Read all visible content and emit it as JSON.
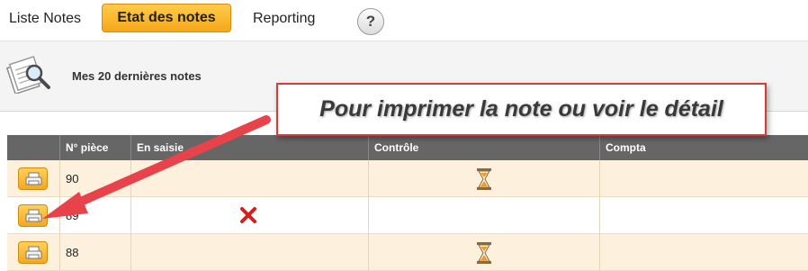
{
  "nav": {
    "items": [
      "Liste Notes",
      "Etat des notes",
      "Reporting"
    ],
    "active_index": 1,
    "help_label": "?"
  },
  "header": {
    "title": "Mes 20 dernières notes",
    "icon": "magnifier-document-icon"
  },
  "table": {
    "columns": [
      "",
      "N° pièce",
      "En saisie",
      "Contrôle",
      "Compta"
    ],
    "rows": [
      {
        "num": "90",
        "en_saisie": "",
        "controle": "hourglass-icon",
        "compta": ""
      },
      {
        "num": "89",
        "en_saisie": "x-icon",
        "controle": "",
        "compta": ""
      },
      {
        "num": "88",
        "en_saisie": "",
        "controle": "hourglass-icon",
        "compta": ""
      }
    ]
  },
  "callout": {
    "text": "Pour imprimer la note ou voir le détail"
  },
  "colors": {
    "accent": "#f7a71a",
    "header_bg": "#666666",
    "row_alt": "#fdf1de",
    "callout_border": "#d93a3a",
    "arrow": "#e8424a",
    "cancel": "#d21f1f"
  }
}
